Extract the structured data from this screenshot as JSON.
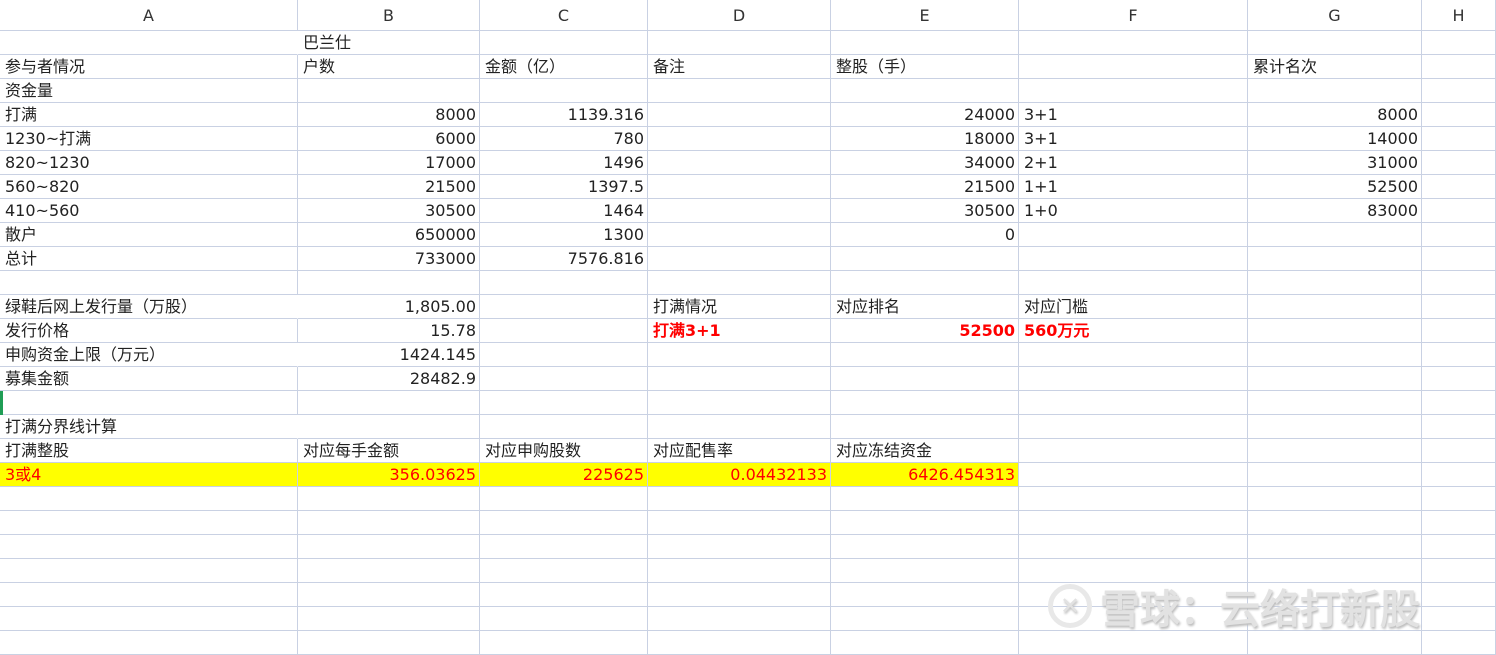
{
  "columns": [
    "A",
    "B",
    "C",
    "D",
    "E",
    "F",
    "G",
    "H"
  ],
  "rows": [
    [
      "",
      "巴兰仕",
      "",
      "",
      "",
      "",
      "",
      ""
    ],
    [
      "参与者情况",
      "户数",
      "金额（亿）",
      "备注",
      "整股（手）",
      "",
      "累计名次",
      ""
    ],
    [
      "资金量",
      "",
      "",
      "",
      "",
      "",
      "",
      ""
    ],
    [
      "打满",
      "8000",
      "1139.316",
      "",
      "24000",
      "3+1",
      "8000",
      ""
    ],
    [
      "1230~打满",
      "6000",
      "780",
      "",
      "18000",
      "3+1",
      "14000",
      ""
    ],
    [
      "820~1230",
      "17000",
      "1496",
      "",
      "34000",
      "2+1",
      "31000",
      ""
    ],
    [
      "560~820",
      "21500",
      "1397.5",
      "",
      "21500",
      "1+1",
      "52500",
      ""
    ],
    [
      "410~560",
      "30500",
      "1464",
      "",
      "30500",
      "1+0",
      "83000",
      ""
    ],
    [
      "散户",
      "650000",
      "1300",
      "",
      "0",
      "",
      "",
      ""
    ],
    [
      "总计",
      "733000",
      "7576.816",
      "",
      "",
      "",
      "",
      ""
    ],
    [
      "",
      "",
      "",
      "",
      "",
      "",
      "",
      ""
    ],
    [
      "绿鞋后网上发行量（万股）",
      "1,805.00",
      "",
      "打满情况",
      "对应排名",
      "对应门槛",
      "",
      ""
    ],
    [
      "发行价格",
      "15.78",
      "",
      "打满3+1",
      "52500",
      "560万元",
      "",
      ""
    ],
    [
      "申购资金上限（万元）",
      "1424.145",
      "",
      "",
      "",
      "",
      "",
      ""
    ],
    [
      "募集金额",
      "28482.9",
      "",
      "",
      "",
      "",
      "",
      ""
    ],
    [
      "",
      "",
      "",
      "",
      "",
      "",
      "",
      ""
    ],
    [
      "打满分界线计算",
      "",
      "",
      "",
      "",
      "",
      "",
      ""
    ],
    [
      "打满整股",
      "对应每手金额",
      "对应申购股数",
      "对应配售率",
      "对应冻结资金",
      "",
      "",
      ""
    ],
    [
      "3或4",
      "356.03625",
      "225625",
      "0.04432133",
      "6426.454313",
      "",
      "",
      ""
    ],
    [
      "",
      "",
      "",
      "",
      "",
      "",
      "",
      ""
    ],
    [
      "",
      "",
      "",
      "",
      "",
      "",
      "",
      ""
    ],
    [
      "",
      "",
      "",
      "",
      "",
      "",
      "",
      ""
    ],
    [
      "",
      "",
      "",
      "",
      "",
      "",
      "",
      ""
    ],
    [
      "",
      "",
      "",
      "",
      "",
      "",
      "",
      ""
    ],
    [
      "",
      "",
      "",
      "",
      "",
      "",
      "",
      ""
    ],
    [
      "",
      "",
      "",
      "",
      "",
      "",
      "",
      ""
    ]
  ],
  "highlight": {
    "yellow": "#ffff00",
    "red": "#ff0000"
  },
  "watermark": {
    "brand": "雪球：云络打新股",
    "icon": "snowball-logo-icon"
  }
}
